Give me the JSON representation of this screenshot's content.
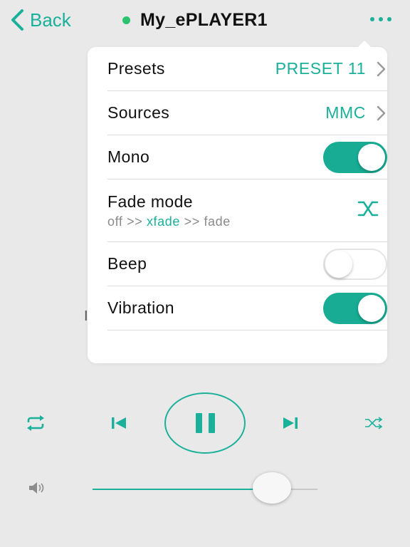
{
  "header": {
    "back_label": "Back",
    "title": "My_ePLAYER1",
    "status_color": "#2bc36d"
  },
  "menu": {
    "presets": {
      "label": "Presets",
      "value": "PRESET 11"
    },
    "sources": {
      "label": "Sources",
      "value": "MMC"
    },
    "mono": {
      "label": "Mono",
      "on": true
    },
    "fade_mode": {
      "label": "Fade mode",
      "options": [
        "off",
        "xfade",
        "fade"
      ],
      "separator": ">>",
      "selected": "xfade"
    },
    "beep": {
      "label": "Beep",
      "on": false
    },
    "vibration": {
      "label": "Vibration",
      "on": true
    }
  },
  "background_text": "I",
  "player": {
    "icons": [
      "repeat-icon",
      "previous-icon",
      "pause-icon",
      "next-icon",
      "shuffle-icon",
      "speaker-icon"
    ],
    "volume_fraction": 0.78
  },
  "colors": {
    "accent": "#1ab09a",
    "background": "#e9e9ea",
    "panel": "#ffffff"
  }
}
